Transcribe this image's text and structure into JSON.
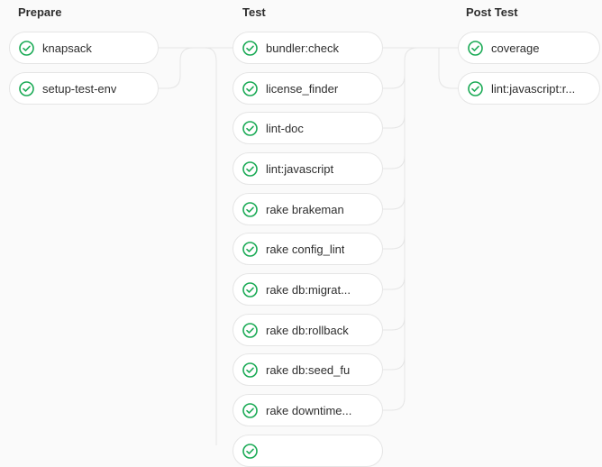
{
  "colors": {
    "success": "#1aaa55",
    "connector": "#e5e5e5",
    "border": "#e5e5e5"
  },
  "stages": [
    {
      "title": "Prepare",
      "jobs": [
        {
          "name": "knapsack",
          "status": "success",
          "icon": "check-circle-icon"
        },
        {
          "name": "setup-test-env",
          "status": "success",
          "icon": "check-circle-icon"
        }
      ]
    },
    {
      "title": "Test",
      "jobs": [
        {
          "name": "bundler:check",
          "status": "success",
          "icon": "check-circle-icon"
        },
        {
          "name": "license_finder",
          "status": "success",
          "icon": "check-circle-icon"
        },
        {
          "name": "lint-doc",
          "status": "success",
          "icon": "check-circle-icon"
        },
        {
          "name": "lint:javascript",
          "status": "success",
          "icon": "check-circle-icon"
        },
        {
          "name": "rake brakeman",
          "status": "success",
          "icon": "check-circle-icon"
        },
        {
          "name": "rake config_lint",
          "status": "success",
          "icon": "check-circle-icon"
        },
        {
          "name": "rake db:migrat...",
          "status": "success",
          "icon": "check-circle-icon"
        },
        {
          "name": "rake db:rollback",
          "status": "success",
          "icon": "check-circle-icon"
        },
        {
          "name": "rake db:seed_fu",
          "status": "success",
          "icon": "check-circle-icon"
        },
        {
          "name": "rake downtime...",
          "status": "success",
          "icon": "check-circle-icon"
        },
        {
          "name": "",
          "status": "success",
          "icon": "check-circle-icon"
        }
      ]
    },
    {
      "title": "Post Test",
      "jobs": [
        {
          "name": "coverage",
          "status": "success",
          "icon": "check-circle-icon"
        },
        {
          "name": "lint:javascript:r...",
          "status": "success",
          "icon": "check-circle-icon"
        }
      ]
    }
  ]
}
